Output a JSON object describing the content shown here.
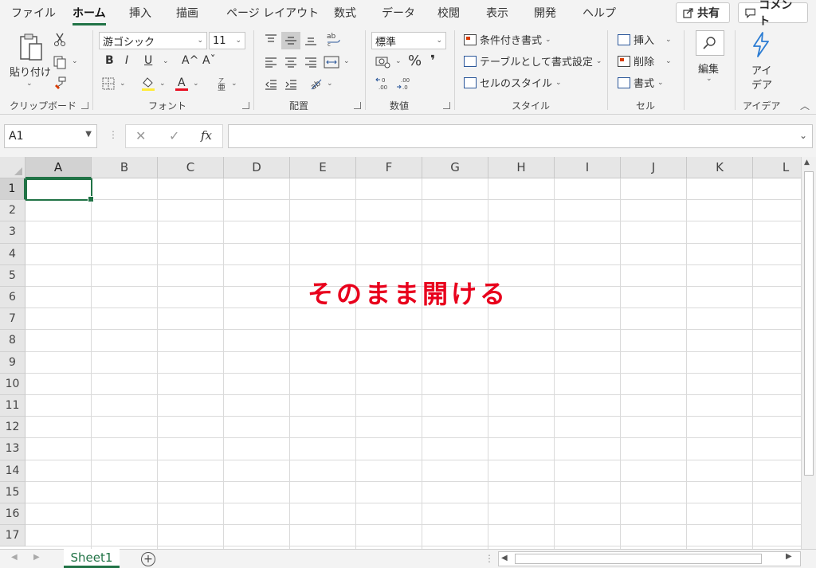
{
  "tabs": [
    {
      "label": "ファイル",
      "active": false
    },
    {
      "label": "ホーム",
      "active": true
    },
    {
      "label": "挿入",
      "active": false
    },
    {
      "label": "描画",
      "active": false
    },
    {
      "label": "ページ レイアウト",
      "active": false
    },
    {
      "label": "数式",
      "active": false
    },
    {
      "label": "データ",
      "active": false
    },
    {
      "label": "校閲",
      "active": false
    },
    {
      "label": "表示",
      "active": false
    },
    {
      "label": "開発",
      "active": false
    },
    {
      "label": "ヘルプ",
      "active": false
    }
  ],
  "share_label": "共有",
  "comment_label": "コメント",
  "ribbon": {
    "clipboard": {
      "paste_label": "貼り付け",
      "group_label": "クリップボード"
    },
    "font": {
      "font_name": "游ゴシック",
      "font_size": "11",
      "bold": "B",
      "italic": "I",
      "underline": "U",
      "grow": "A^",
      "shrink": "Aˇ",
      "group_label": "フォント"
    },
    "alignment": {
      "group_label": "配置"
    },
    "number": {
      "format": "標準",
      "percent": "%",
      "comma": "❜",
      "group_label": "数値"
    },
    "styles": {
      "conditional": "条件付き書式",
      "table": "テーブルとして書式設定",
      "cell_styles": "セルのスタイル",
      "group_label": "スタイル"
    },
    "cells": {
      "insert": "挿入",
      "delete": "削除",
      "format": "書式",
      "group_label": "セル"
    },
    "editing": {
      "label": "編集"
    },
    "ideas": {
      "label_line1": "アイ",
      "label_line2": "デア",
      "group_label": "アイデア"
    }
  },
  "name_box": "A1",
  "formula_fx": "fx",
  "formula_value": "",
  "columns": [
    "A",
    "B",
    "C",
    "D",
    "E",
    "F",
    "G",
    "H",
    "I",
    "J",
    "K",
    "L"
  ],
  "rows": [
    "1",
    "2",
    "3",
    "4",
    "5",
    "6",
    "7",
    "8",
    "9",
    "10",
    "11",
    "12",
    "13",
    "14",
    "15",
    "16",
    "17"
  ],
  "selected_cell": "A1",
  "overlay_text": "そのまま開ける",
  "sheet_tab": "Sheet1",
  "colors": {
    "accent": "#217346",
    "overlay": "#e8001c"
  }
}
